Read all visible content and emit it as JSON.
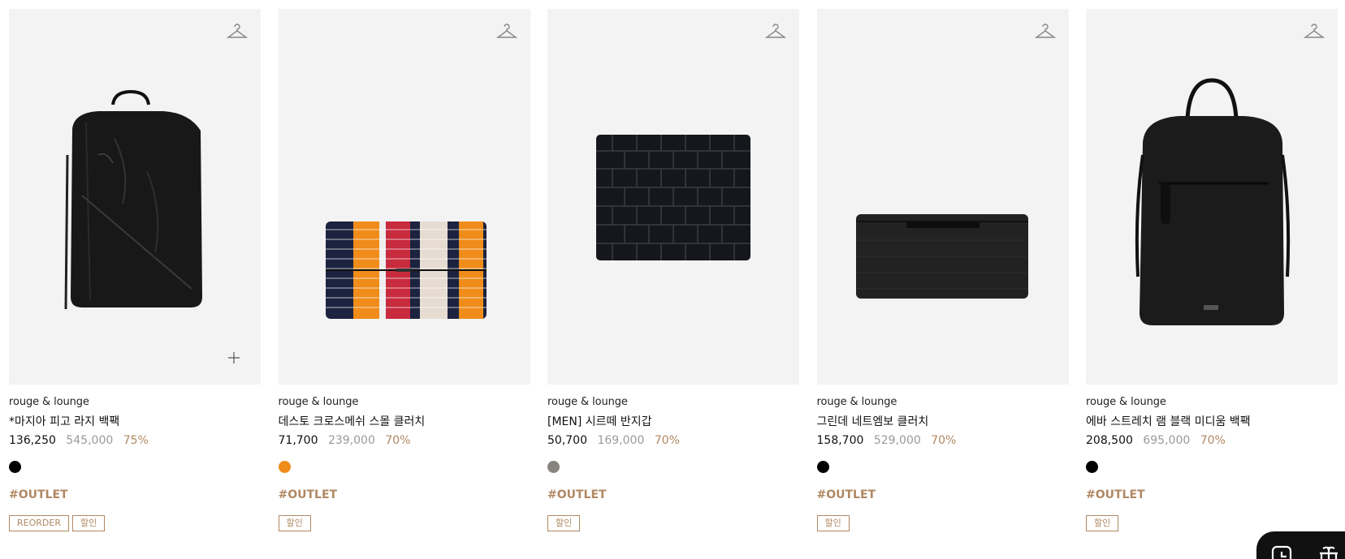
{
  "products": [
    {
      "brand": "rouge & lounge",
      "name": "*마지아 피고 라지 백팩",
      "price": "136,250",
      "original_price": "545,000",
      "discount": "75%",
      "colors": [
        "#000000"
      ],
      "tag": "#OUTLET",
      "badges": [
        "REORDER",
        "할인"
      ],
      "image_icon": "black-backpack"
    },
    {
      "brand": "rouge & lounge",
      "name": "데스토 크로스메쉬 스몰 클러치",
      "price": "71,700",
      "original_price": "239,000",
      "discount": "70%",
      "colors": [
        "#f08c1a"
      ],
      "tag": "#OUTLET",
      "badges": [
        "할인"
      ],
      "image_icon": "striped-clutch"
    },
    {
      "brand": "rouge & lounge",
      "name": "[MEN] 시르떼 반지갑",
      "price": "50,700",
      "original_price": "169,000",
      "discount": "70%",
      "colors": [
        "#86847c"
      ],
      "tag": "#OUTLET",
      "badges": [
        "할인"
      ],
      "image_icon": "croc-wallet"
    },
    {
      "brand": "rouge & lounge",
      "name": "그린데 네트엠보 클러치",
      "price": "158,700",
      "original_price": "529,000",
      "discount": "70%",
      "colors": [
        "#000000"
      ],
      "tag": "#OUTLET",
      "badges": [
        "할인"
      ],
      "image_icon": "black-clutch"
    },
    {
      "brand": "rouge & lounge",
      "name": "에바 스트레치 램 블랙 미디움 백팩",
      "price": "208,500",
      "original_price": "695,000",
      "discount": "70%",
      "colors": [
        "#000000"
      ],
      "tag": "#OUTLET",
      "badges": [
        "할인"
      ],
      "image_icon": "black-medium-backpack"
    }
  ],
  "accent_color": "#b08863",
  "floating_bar": {
    "icons": [
      "clock-icon",
      "gift-icon"
    ]
  }
}
